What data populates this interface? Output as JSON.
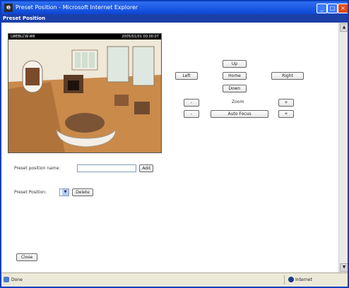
{
  "window": {
    "title": "Preset Position - Microsoft Internet Explorer",
    "icon": "ie-page-icon",
    "controls": [
      "minimize-icon",
      "maximize-icon",
      "close-icon"
    ]
  },
  "page": {
    "header": "Preset Position"
  },
  "camera": {
    "overlay_left": "LWEBLCW-W6",
    "overlay_right": "2005/01/01 00:00:07"
  },
  "ptz": {
    "up": "Up",
    "left": "Left",
    "home": "Home",
    "right": "Right",
    "down": "Down",
    "zoom_label": "Zoom",
    "zoom_minus": "-",
    "zoom_plus": "+",
    "focus_minus": "-",
    "focus_plus": "+",
    "auto_focus": "Auto Focus"
  },
  "preset": {
    "name_label": "Preset position name:",
    "name_value": "",
    "add_button": "Add",
    "positions_label": "Preset Position:",
    "selected": "",
    "delete_button": "Delete"
  },
  "footer": {
    "close_button": "Close"
  },
  "status": {
    "text": "Done",
    "zone": "Internet"
  }
}
